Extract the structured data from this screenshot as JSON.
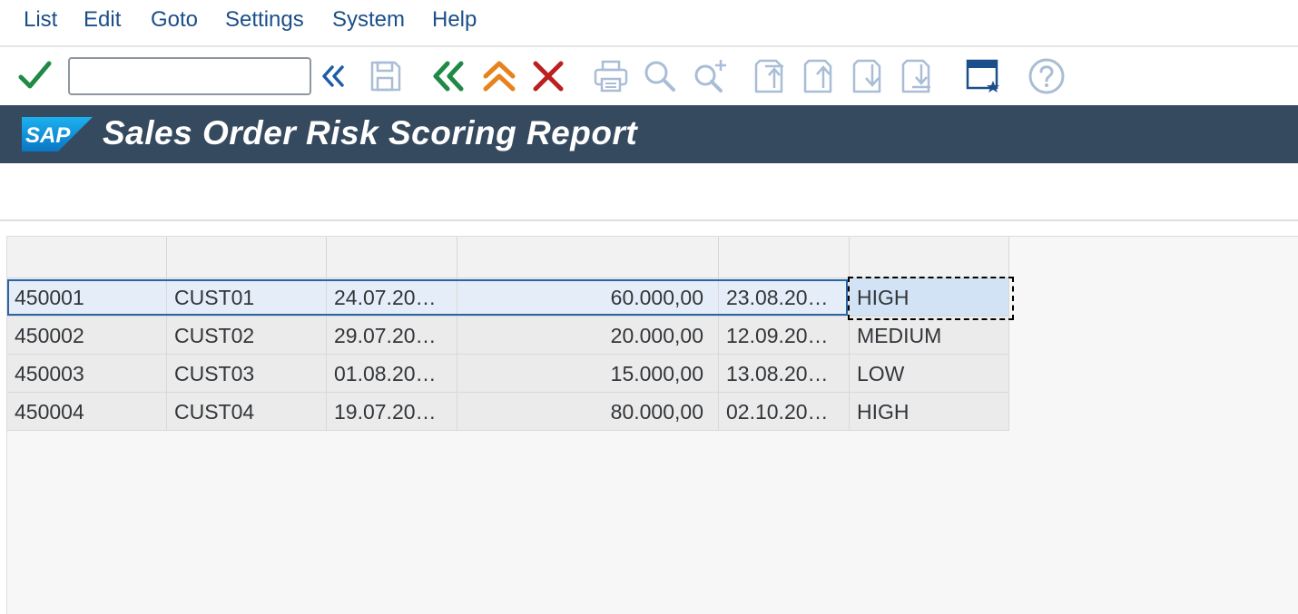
{
  "menu": [
    "List",
    "Edit",
    "Goto",
    "Settings",
    "System",
    "Help"
  ],
  "toolbar": {
    "command_field_value": "",
    "icons": [
      "check-icon",
      "back-nav-icon",
      "save-icon",
      "back-icon",
      "exit-icon",
      "cancel-icon",
      "print-icon",
      "find-icon",
      "find-next-icon",
      "first-page-icon",
      "previous-page-icon",
      "next-page-icon",
      "last-page-icon",
      "new-session-icon",
      "help-icon"
    ]
  },
  "title": "Sales Order Risk Scoring Report",
  "logo_text": "SAP",
  "colors": {
    "title_bar": "#354a5f",
    "menu_text": "#1c4f8a",
    "check_green": "#1f8a45",
    "exit_orange": "#e8821d",
    "cancel_red": "#bb1f1f",
    "selection_blue": "#e5eef8"
  },
  "table": {
    "headers": [
      "",
      "",
      "",
      "",
      "",
      ""
    ],
    "rows": [
      [
        "450001",
        "CUST01",
        "24.07.20…",
        "60.000,00",
        "23.08.20…",
        "HIGH"
      ],
      [
        "450002",
        "CUST02",
        "29.07.20…",
        "20.000,00",
        "12.09.20…",
        "MEDIUM"
      ],
      [
        "450003",
        "CUST03",
        "01.08.20…",
        "15.000,00",
        "13.08.20…",
        "LOW"
      ],
      [
        "450004",
        "CUST04",
        "19.07.20…",
        "80.000,00",
        "02.10.20…",
        "HIGH"
      ]
    ]
  }
}
